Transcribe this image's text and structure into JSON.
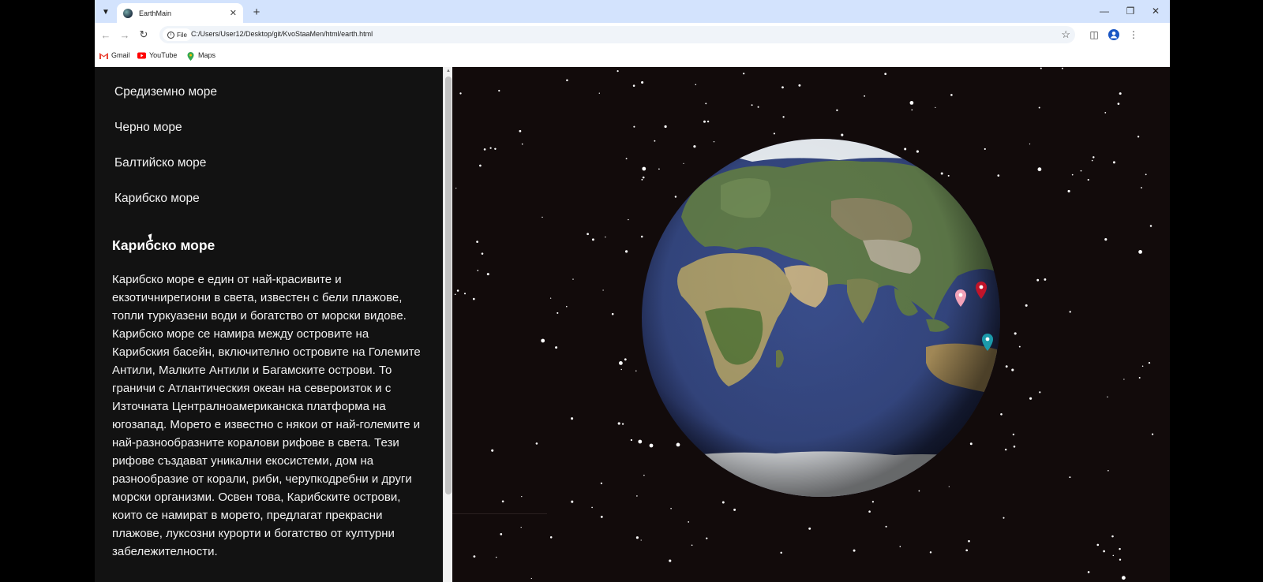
{
  "browser": {
    "tab_title": "EarthMain",
    "url_chip": "File",
    "url": "C:/Users/User12/Desktop/git/KvoStaaMen/html/earth.html",
    "bookmarks": [
      {
        "label": "Gmail",
        "icon": "gmail-icon",
        "color": "#ea4335"
      },
      {
        "label": "YouTube",
        "icon": "youtube-icon",
        "color": "#ff0000"
      },
      {
        "label": "Maps",
        "icon": "maps-icon",
        "color": "#34a853"
      }
    ]
  },
  "sidebar": {
    "items": [
      {
        "label": "Средиземно море"
      },
      {
        "label": "Черно море"
      },
      {
        "label": "Балтийско море"
      },
      {
        "label": "Карибско море"
      }
    ]
  },
  "detail": {
    "title": "Карибско море",
    "description": "Карибско море е един от най-красивите и екзотичнирегиони в света, известен с бели плажове, топли туркуазени води и богатство от морски видове. Карибско море се намира между островите на Карибския басейн, включително островите на Големите Антили, Малките Антили и Багамските острови. То граничи с Атлантическия океан на североизток и с Източната Централноамериканска платформа на югозапад. Морето е известно с някои от най-големите и най-разнообразните коралови рифове в света. Тези рифове създават уникални екосистеми, дом на разнообразие от корали, риби, черупкодребни и други морски организми. Освен това, Карибските острови, които се намират в морето, предлагат прекрасни плажове, луксозни курорти и богатство от културни забележителности."
  },
  "globe": {
    "markers": [
      {
        "color": "#f2a2b8",
        "name": "pink"
      },
      {
        "color": "#c0142a",
        "name": "red"
      },
      {
        "color": "#1b9aaa",
        "name": "teal"
      }
    ]
  }
}
